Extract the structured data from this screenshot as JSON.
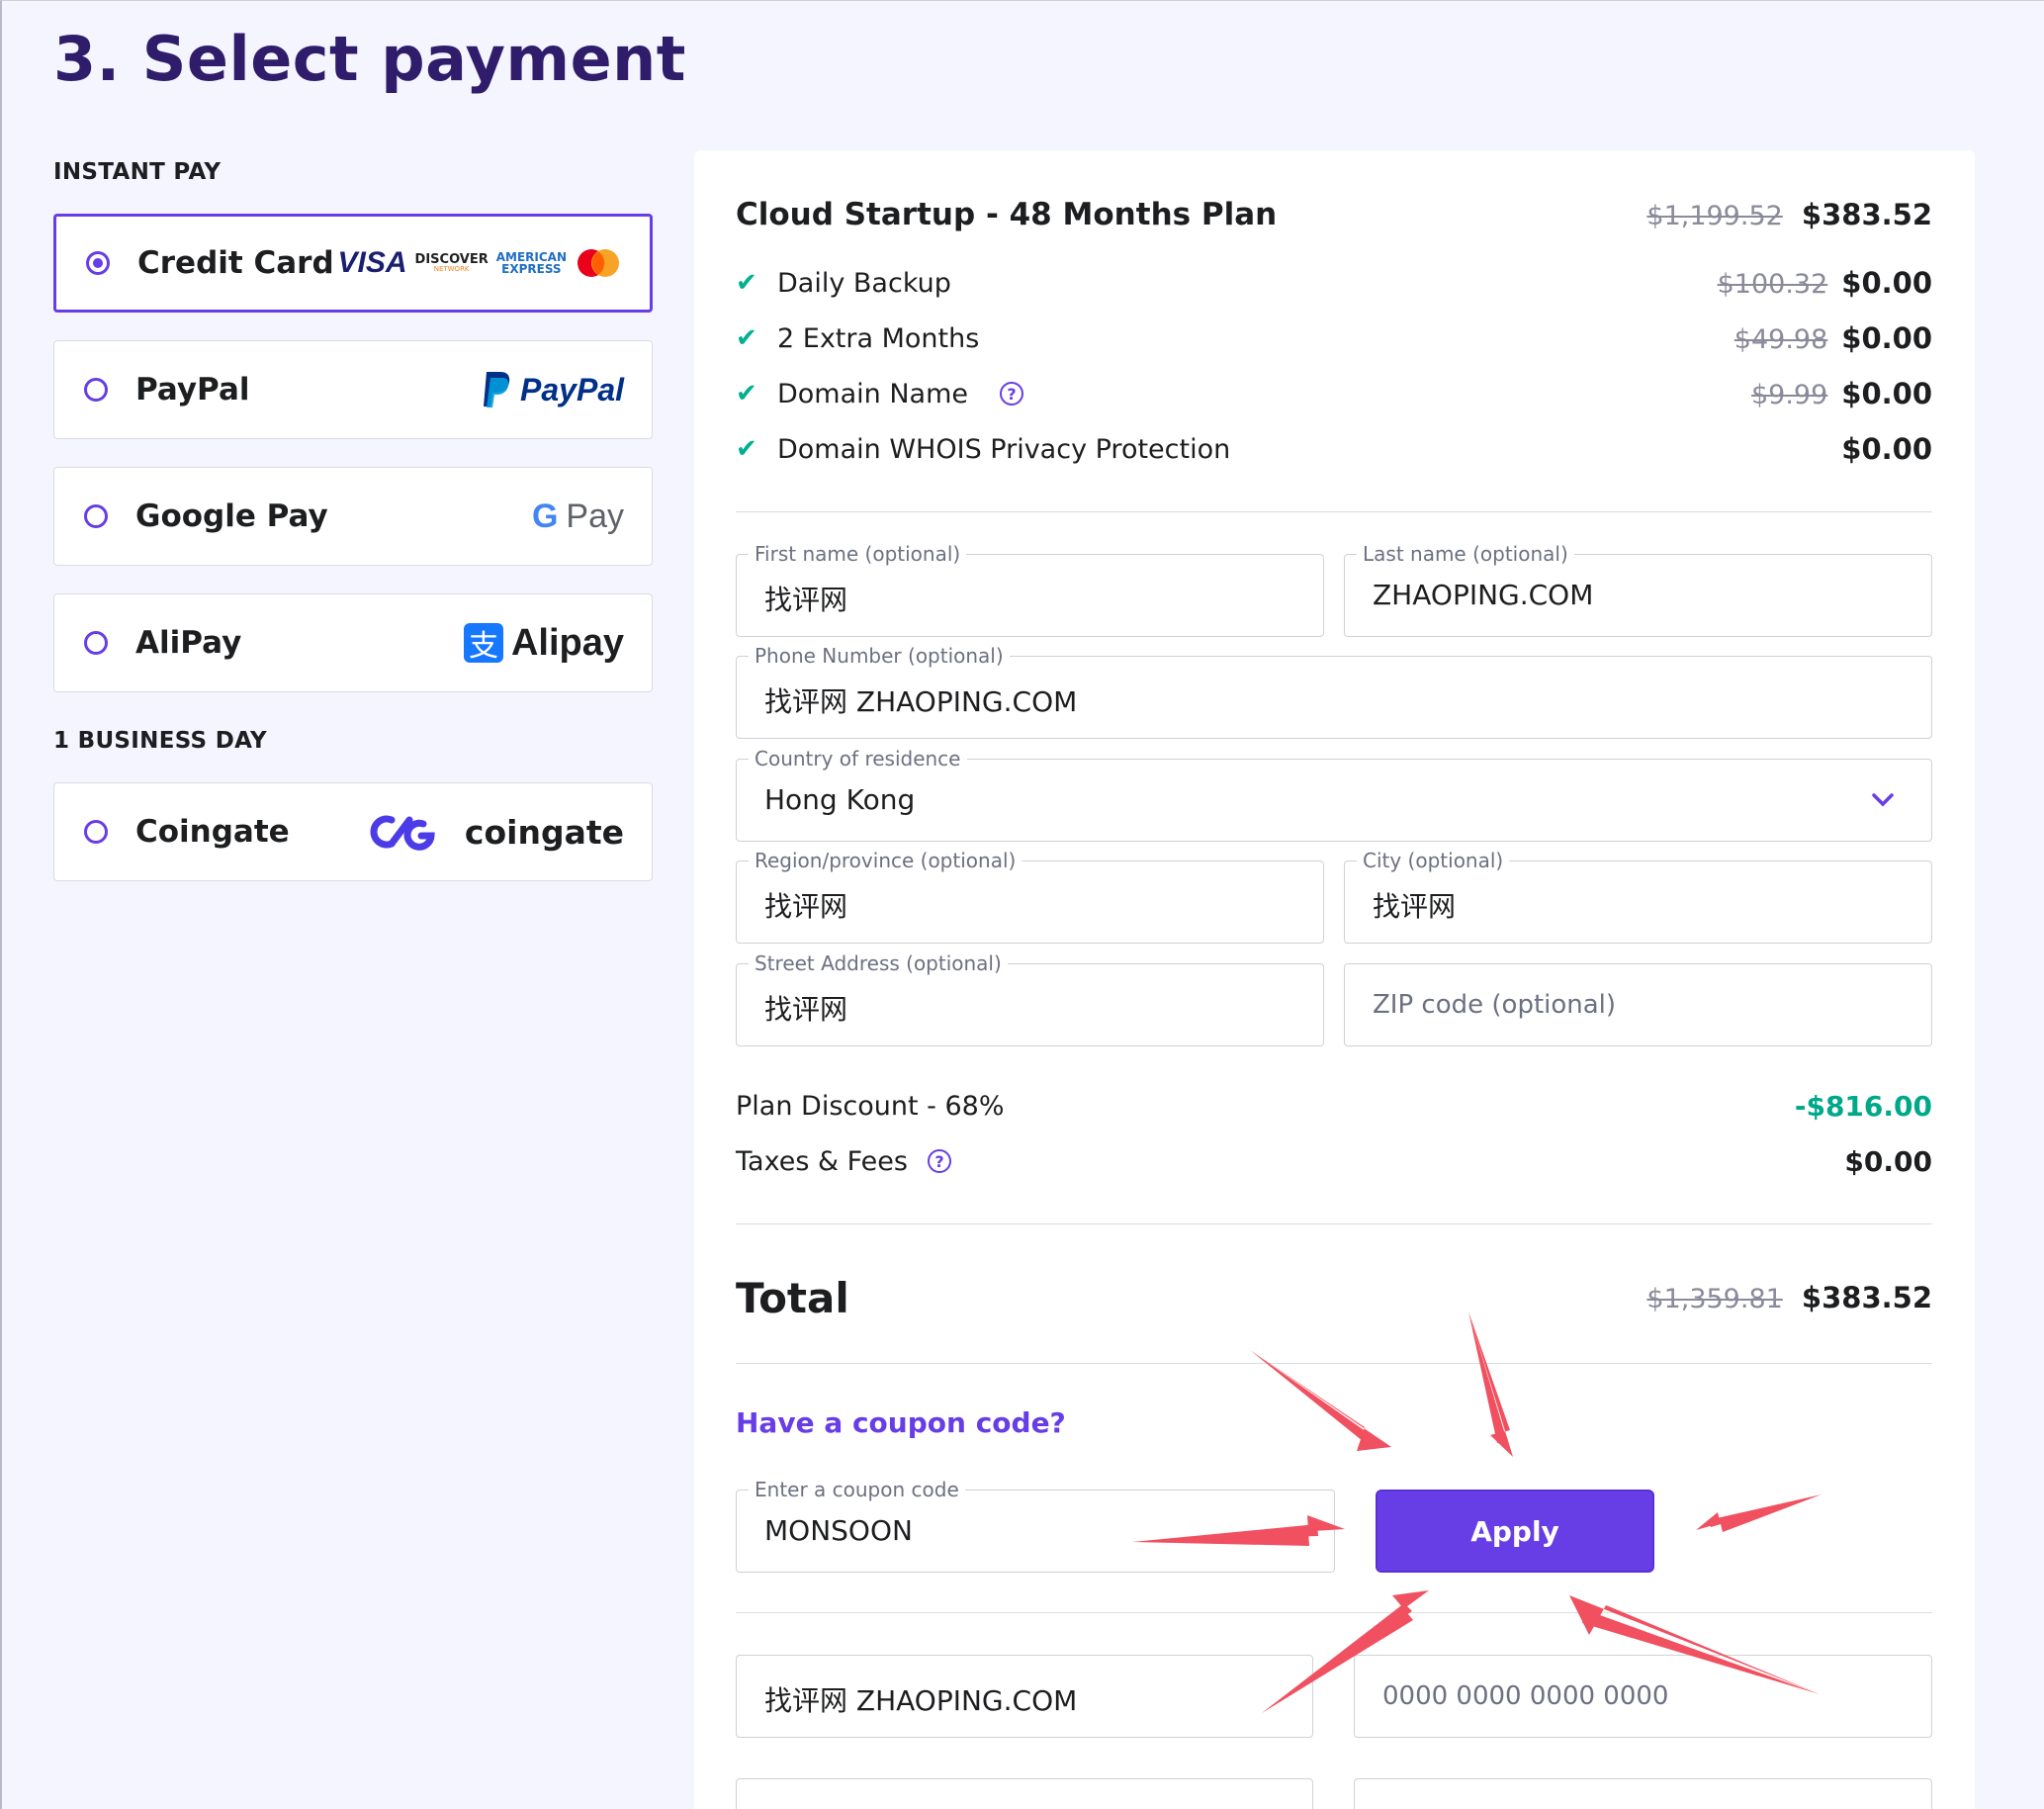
{
  "page": {
    "title": "3. Select payment"
  },
  "left": {
    "instant_label": "INSTANT PAY",
    "business_label": "1 BUSINESS DAY",
    "methods": [
      {
        "name": "Credit Card",
        "selected": true
      },
      {
        "name": "PayPal",
        "selected": false,
        "brand": "PayPal"
      },
      {
        "name": "Google Pay",
        "selected": false,
        "brand": "Pay"
      },
      {
        "name": "AliPay",
        "selected": false,
        "brand": "Alipay"
      },
      {
        "name": "Coingate",
        "selected": false,
        "brand": "coingate"
      }
    ],
    "card_brands": {
      "visa": "VISA",
      "discover": "DISCOVER",
      "discover_sub": "NETWORK",
      "amex_1": "AMERICAN",
      "amex_2": "EXPRESS"
    },
    "alipay_mark": "支",
    "google_g": "G"
  },
  "summary": {
    "plan": {
      "name": "Cloud Startup - 48 Months Plan",
      "old_price": "$1,199.52",
      "price": "$383.52"
    },
    "features": [
      {
        "label": "Daily Backup",
        "old_price": "$100.32",
        "price": "$0.00",
        "help": false
      },
      {
        "label": "2 Extra Months",
        "old_price": "$49.98",
        "price": "$0.00",
        "help": false
      },
      {
        "label": "Domain Name",
        "old_price": "$9.99",
        "price": "$0.00",
        "help": true
      },
      {
        "label": "Domain WHOIS Privacy Protection",
        "old_price": "",
        "price": "$0.00",
        "help": false
      }
    ],
    "check_glyph": "✔",
    "help_glyph": "?",
    "form": {
      "first_name": {
        "label": "First name (optional)",
        "value": "找评网"
      },
      "last_name": {
        "label": "Last name (optional)",
        "value": "ZHAOPING.COM"
      },
      "phone": {
        "label": "Phone Number (optional)",
        "value": "找评网 ZHAOPING.COM"
      },
      "country": {
        "label": "Country of residence",
        "value": "Hong Kong"
      },
      "region": {
        "label": "Region/province (optional)",
        "value": "找评网"
      },
      "city": {
        "label": "City (optional)",
        "value": "找评网"
      },
      "street": {
        "label": "Street Address (optional)",
        "value": "找评网"
      },
      "zip": {
        "placeholder": "ZIP code (optional)"
      }
    },
    "discount": {
      "label": "Plan Discount - 68%",
      "value": "-$816.00"
    },
    "taxes": {
      "label": "Taxes & Fees",
      "value": "$0.00"
    },
    "total": {
      "label": "Total",
      "old_price": "$1,359.81",
      "price": "$383.52"
    },
    "coupon": {
      "link": "Have a coupon code?",
      "label": "Enter a coupon code",
      "value": "MONSOON",
      "apply": "Apply"
    },
    "card": {
      "holder_value": "找评网 ZHAOPING.COM",
      "number_placeholder": "0000 0000 0000 0000"
    }
  },
  "colors": {
    "accent": "#673de6",
    "title": "#2f1c6a",
    "discount": "#00a88a",
    "arrow": "#f0505f"
  }
}
